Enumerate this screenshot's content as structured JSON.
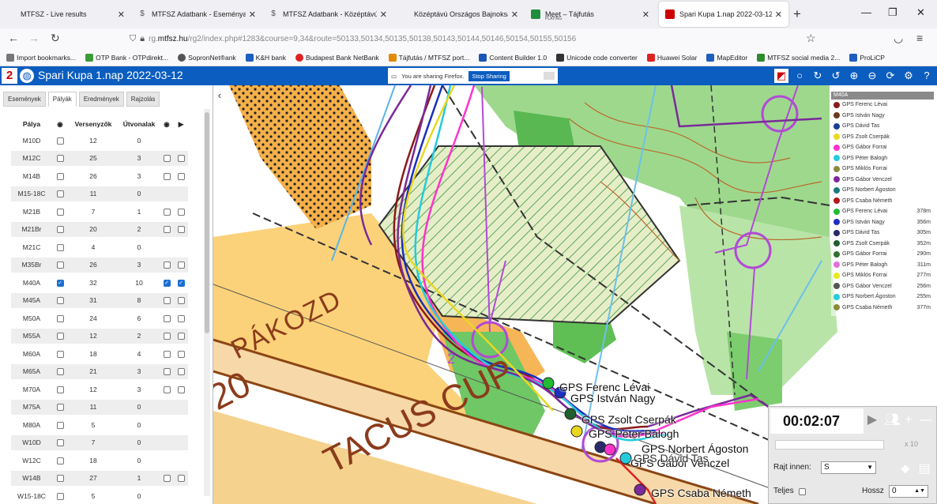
{
  "browser": {
    "tabs": [
      {
        "title": "MTFSZ - Live results",
        "icon": "mtfsz-icon"
      },
      {
        "title": "MTFSZ Adatbank - Eseményajá",
        "icon": "dollar-icon"
      },
      {
        "title": "MTFSZ Adatbank - Középtávú O",
        "icon": "dollar-icon"
      },
      {
        "title": "Középtávú Országos Bajnokság 2022",
        "icon": "page-icon"
      },
      {
        "title": "Meet – Tájfutás",
        "subtitle": "PLAYING",
        "icon": "meet-icon"
      },
      {
        "title": "Spari Kupa 1.nap 2022-03-12",
        "icon": "map-icon"
      }
    ],
    "url_prefix": "rg.",
    "url_host": "mtfsz.hu",
    "url_path": "/rg2/index.php#1283&course=9,34&route=50133,50134,50135,50138,50143,50144,50146,50154,50155,50156",
    "bookmarks": [
      {
        "label": "Import bookmarks...",
        "color": "#777"
      },
      {
        "label": "OTP Bank - OTPdirekt...",
        "color": "#3b9b3b"
      },
      {
        "label": "SopronNet®ank",
        "color": "#555"
      },
      {
        "label": "K&H bank",
        "color": "#1f5fbf"
      },
      {
        "label": "Budapest Bank NetBank",
        "color": "#d22"
      },
      {
        "label": "Tájfutás / MTFSZ port...",
        "color": "#e48a00"
      },
      {
        "label": "Content Builder 1.0",
        "color": "#1a57b5"
      },
      {
        "label": "Unicode code converter",
        "color": "#333"
      },
      {
        "label": "Huawei Solar",
        "color": "#d22"
      },
      {
        "label": "MapEditor",
        "color": "#1f5fbf"
      },
      {
        "label": "MTFSZ social media 2...",
        "color": "#2e8b2e"
      },
      {
        "label": "ProLiCP",
        "color": "#1f5fbf"
      }
    ]
  },
  "app": {
    "title": "Spari Kupa 1.nap 2022-03-12",
    "logo_text": "2",
    "share_text": "You are sharing Firefox.",
    "stop_sharing": "Stop Sharing",
    "header_color": "#0b5dbf"
  },
  "panel": {
    "tabs": [
      "Események",
      "Pályák",
      "Eredmények",
      "Rajzolás"
    ],
    "active_tab": "Pályák",
    "headers": {
      "course": "Pálya",
      "competitors": "Versenyzők",
      "routes": "Útvonalak"
    },
    "rows": [
      {
        "course": "M10D",
        "competitors": "12",
        "routes": "0",
        "show": false,
        "extra": false
      },
      {
        "course": "M12C",
        "competitors": "25",
        "routes": "3",
        "show": false,
        "extra": true,
        "extra_on": false
      },
      {
        "course": "M14B",
        "competitors": "26",
        "routes": "3",
        "show": false,
        "extra": true,
        "extra_on": false
      },
      {
        "course": "M15-18C",
        "competitors": "11",
        "routes": "0",
        "show": false,
        "extra": false
      },
      {
        "course": "M21B",
        "competitors": "7",
        "routes": "1",
        "show": false,
        "extra": true,
        "extra_on": false
      },
      {
        "course": "M21Br",
        "competitors": "20",
        "routes": "2",
        "show": false,
        "extra": true,
        "extra_on": false
      },
      {
        "course": "M21C",
        "competitors": "4",
        "routes": "0",
        "show": false,
        "extra": false
      },
      {
        "course": "M35Br",
        "competitors": "26",
        "routes": "3",
        "show": false,
        "extra": true,
        "extra_on": false
      },
      {
        "course": "M40A",
        "competitors": "32",
        "routes": "10",
        "show": true,
        "extra": true,
        "extra_on": true
      },
      {
        "course": "M45A",
        "competitors": "31",
        "routes": "8",
        "show": false,
        "extra": true,
        "extra_on": false
      },
      {
        "course": "M50A",
        "competitors": "24",
        "routes": "6",
        "show": false,
        "extra": true,
        "extra_on": false
      },
      {
        "course": "M55A",
        "competitors": "12",
        "routes": "2",
        "show": false,
        "extra": true,
        "extra_on": false
      },
      {
        "course": "M60A",
        "competitors": "18",
        "routes": "4",
        "show": false,
        "extra": true,
        "extra_on": false
      },
      {
        "course": "M65A",
        "competitors": "21",
        "routes": "3",
        "show": false,
        "extra": true,
        "extra_on": false
      },
      {
        "course": "M70A",
        "competitors": "12",
        "routes": "3",
        "show": false,
        "extra": true,
        "extra_on": false
      },
      {
        "course": "M75A",
        "competitors": "11",
        "routes": "0",
        "show": false,
        "extra": false
      },
      {
        "course": "M80A",
        "competitors": "5",
        "routes": "0",
        "show": false,
        "extra": false
      },
      {
        "course": "W10D",
        "competitors": "7",
        "routes": "0",
        "show": false,
        "extra": false
      },
      {
        "course": "W12C",
        "competitors": "18",
        "routes": "0",
        "show": false,
        "extra": false
      },
      {
        "course": "W14B",
        "competitors": "27",
        "routes": "1",
        "show": false,
        "extra": true,
        "extra_on": false
      },
      {
        "course": "W15-18C",
        "competitors": "5",
        "routes": "0",
        "show": false,
        "extra": false
      }
    ]
  },
  "legend": {
    "title": "M40A",
    "entries": [
      {
        "name": "GPS Ferenc Lévai",
        "color": "#8b1a1a",
        "dist": ""
      },
      {
        "name": "GPS István Nagy",
        "color": "#6b3a1a",
        "dist": ""
      },
      {
        "name": "GPS Dávid Tas",
        "color": "#1c3f8f",
        "dist": ""
      },
      {
        "name": "GPS Zsolt Cserpák",
        "color": "#e8d820",
        "dist": ""
      },
      {
        "name": "GPS Gábor Forrai",
        "color": "#ff33cc",
        "dist": ""
      },
      {
        "name": "GPS Péter Balogh",
        "color": "#22ccdd",
        "dist": ""
      },
      {
        "name": "GPS Miklós Forrai",
        "color": "#8a8a3a",
        "dist": ""
      },
      {
        "name": "GPS Gábor Venczel",
        "color": "#7a2a99",
        "dist": ""
      },
      {
        "name": "GPS Norbert Ágoston",
        "color": "#1a7a7a",
        "dist": ""
      },
      {
        "name": "GPS Csaba Németh",
        "color": "#b5151b",
        "dist": ""
      },
      {
        "name": "GPS Ferenc Lévai",
        "color": "#22bb33",
        "dist": "378m"
      },
      {
        "name": "GPS István Nagy",
        "color": "#1c2fbf",
        "dist": "356m"
      },
      {
        "name": "GPS Dávid Tas",
        "color": "#2a2a6a",
        "dist": "305m"
      },
      {
        "name": "GPS Zsolt Cserpák",
        "color": "#1f5f2f",
        "dist": "352m"
      },
      {
        "name": "GPS Gábor Forrai",
        "color": "#2f6f2f",
        "dist": "290m"
      },
      {
        "name": "GPS Péter Balogh",
        "color": "#e070e0",
        "dist": "311m"
      },
      {
        "name": "GPS Miklós Forrai",
        "color": "#e8e820",
        "dist": "277m"
      },
      {
        "name": "GPS Gábor Venczel",
        "color": "#555",
        "dist": "256m"
      },
      {
        "name": "GPS Norbert Ágoston",
        "color": "#22ccdd",
        "dist": "255m"
      },
      {
        "name": "GPS Csaba Németh",
        "color": "#8a8a3a",
        "dist": "377m"
      },
      {
        "name": "",
        "color": "#7a2a99",
        "dist": ""
      }
    ]
  },
  "map_text": {
    "pakozd": "PÁKOZD",
    "cup": "TACUS CUP",
    "year": "20",
    "control_number": "2"
  },
  "runners": [
    {
      "name": "GPS Ferenc Lévai",
      "color": "#22bb33"
    },
    {
      "name": "GPS István Nagy",
      "color": "#1c2fbf"
    },
    {
      "name": "GPS Zsolt Cserpák",
      "color": "#1f5f2f"
    },
    {
      "name": "GPS Péter Balogh",
      "color": "#e8d820"
    },
    {
      "name": "GPS Norbert Ágoston",
      "color": "#2a2a6a"
    },
    {
      "name": "GPS Gábor Venczel",
      "color": "#ff33cc"
    },
    {
      "name": "GPS Dávid Tas",
      "color": "#22ccdd"
    },
    {
      "name": "GPS Csaba Németh",
      "color": "#7a2a99"
    }
  ],
  "controls": {
    "time": "00:02:07",
    "speed": "x 10",
    "start_label": "Rajt innen:",
    "start_value": "S",
    "full_label": "Teljes",
    "length_label": "Hossz",
    "length_value": "0"
  }
}
